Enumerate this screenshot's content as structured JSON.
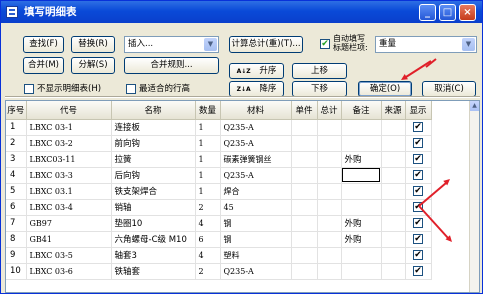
{
  "window": {
    "title": "填写明细表"
  },
  "toolbar": {
    "find_label": "查找(F)",
    "replace_label": "替换(R)",
    "merge_label": "合并(M)",
    "split_label": "分解(S)",
    "insert_select": "插入...",
    "merge_rule_label": "合并规则...",
    "calc_total_label": "计算总计(重)(T)...",
    "autofill_label": "自动填写\n标题栏项:",
    "autofill_select": "重量",
    "hide_detail_label": "不显示明细表(H)",
    "best_row_height_label": "最适合的行高",
    "sort_asc_label": "升序",
    "sort_desc_label": "降序",
    "move_up_label": "上移",
    "move_down_label": "下移",
    "ok_label": "确定(O)",
    "cancel_label": "取消(C)",
    "sort_asc_icon": "A↓Z",
    "sort_desc_icon": "Z↓A"
  },
  "table": {
    "headers": [
      "序号",
      "代号",
      "名称",
      "数量",
      "材料",
      "单件",
      "总计",
      "备注",
      "来源",
      "显示"
    ],
    "rows": [
      {
        "seq": "1",
        "code": "LBXC 03-1",
        "name": "连接板",
        "qty": "1",
        "material": "Q235-A",
        "note": "",
        "show": true
      },
      {
        "seq": "2",
        "code": "LBXC 03-2",
        "name": "前向钩",
        "qty": "1",
        "material": "Q235-A",
        "note": "",
        "show": true
      },
      {
        "seq": "3",
        "code": "LBXC03-11",
        "name": "拉簧",
        "qty": "1",
        "material": "碳素弹簧钢丝",
        "note": "外购",
        "show": true
      },
      {
        "seq": "4",
        "code": "LBXC 03-3",
        "name": "后向钩",
        "qty": "1",
        "material": "Q235-A",
        "note": "",
        "show": true
      },
      {
        "seq": "5",
        "code": "LBXC 03.1",
        "name": "铁支架焊合",
        "qty": "1",
        "material": "焊合",
        "note": "",
        "show": true
      },
      {
        "seq": "6",
        "code": "LBXC 03-4",
        "name": "销轴",
        "qty": "2",
        "material": "45",
        "note": "",
        "show": true
      },
      {
        "seq": "7",
        "code": "GB97",
        "name": "垫圈10",
        "qty": "4",
        "material": "钢",
        "note": "外购",
        "show": true
      },
      {
        "seq": "8",
        "code": "GB41",
        "name": "六角螺母-C级 M10",
        "qty": "6",
        "material": "钢",
        "note": "外购",
        "show": true
      },
      {
        "seq": "9",
        "code": "LBXC 03-5",
        "name": "轴套3",
        "qty": "4",
        "material": "塑料",
        "note": "",
        "show": true
      },
      {
        "seq": "10",
        "code": "LBXC 03-6",
        "name": "铁轴套",
        "qty": "2",
        "material": "Q235-A",
        "note": "",
        "show": true
      }
    ]
  },
  "colors": {
    "titlebar": "#0a4ad8",
    "annotation_arrow": "#e0202a"
  }
}
